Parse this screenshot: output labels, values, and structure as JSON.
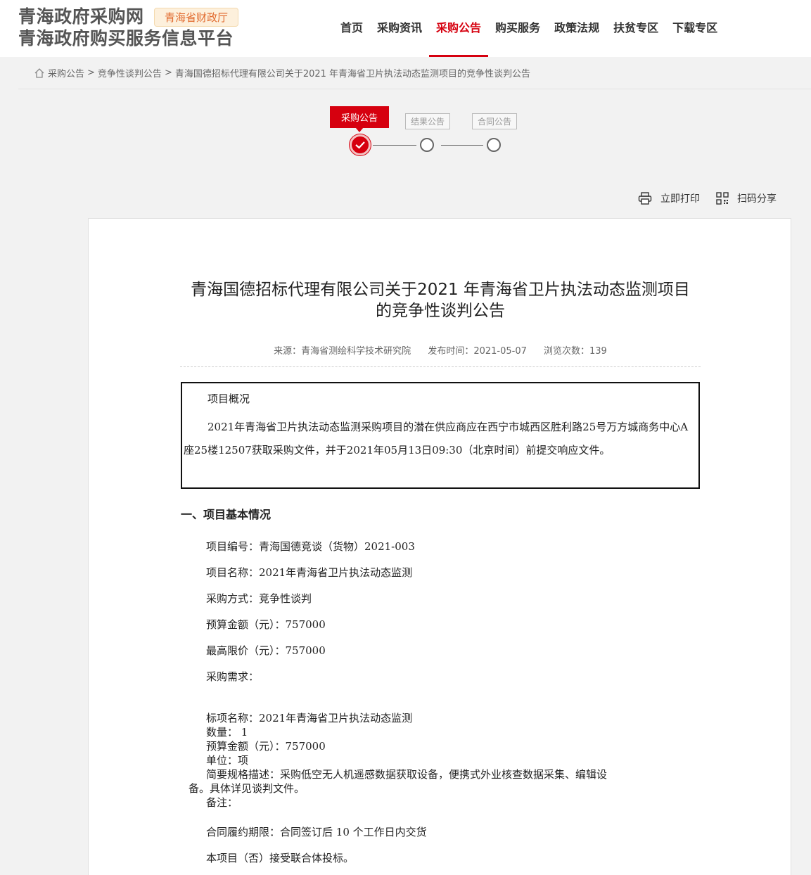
{
  "header": {
    "logo_line1": "青海政府采购网",
    "logo_line2": "青海政府购买服务信息平台",
    "badge": "青海省财政厅",
    "nav": [
      "首页",
      "采购资讯",
      "采购公告",
      "购买服务",
      "政策法规",
      "扶贫专区",
      "下载专区"
    ],
    "active_nav": "采购公告"
  },
  "breadcrumb": [
    "采购公告",
    "竞争性谈判公告",
    "青海国德招标代理有限公司关于2021 年青海省卫片执法动态监测项目的竞争性谈判公告"
  ],
  "steps": [
    "采购公告",
    "结果公告",
    "合同公告"
  ],
  "tools": {
    "print": "立即打印",
    "share": "扫码分享"
  },
  "article": {
    "title_line1": "青海国德招标代理有限公司关于2021 年青海省卫片执法动态监测项目",
    "title_line2": "的竞争性谈判公告",
    "source": "来源：青海省测绘科学技术研究院",
    "publish": "发布时间：2021-05-07",
    "views": "浏览次数：139",
    "overview_head": "项目概况",
    "overview_body": "2021年青海省卫片执法动态监测采购项目的潜在供应商应在西宁市城西区胜利路25号万方城商务中心A座25楼12507获取采购文件，并于2021年05月13日09:30（北京时间）前提交响应文件。",
    "section1": "一、项目基本情况",
    "lines": [
      "项目编号：青海国德竞谈（货物）2021-003",
      "项目名称：2021年青海省卫片执法动态监测",
      "采购方式：竞争性谈判",
      "预算金额（元）：757000",
      "最高限价（元）：757000",
      "采购需求："
    ],
    "detail": [
      "标项名称：2021年青海省卫片执法动态监测",
      "数量： 1",
      "预算金额（元）：757000",
      "单位：项",
      "简要规格描述：采购低空无人机遥感数据获取设备，便携式外业核查数据采集、编辑设",
      "备。具体详见谈判文件。",
      "备注："
    ],
    "period": "合同履约期限：合同签订后 10 个工作日内交货",
    "consortium": "本项目（否）接受联合体投标。"
  }
}
